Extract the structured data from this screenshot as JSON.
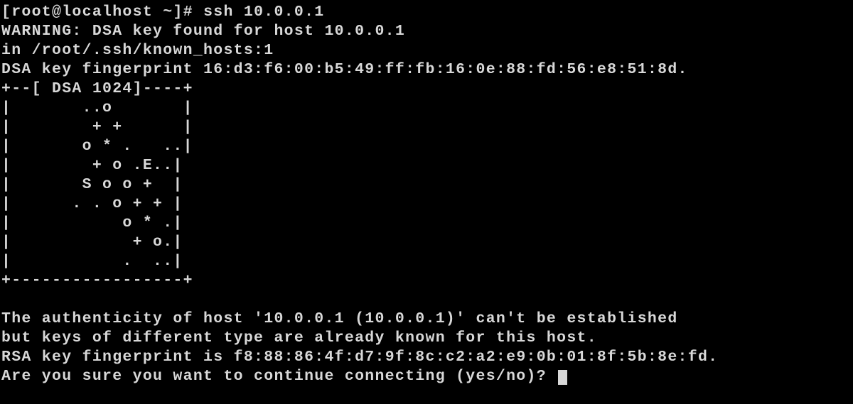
{
  "prompt": {
    "user": "root",
    "host": "localhost",
    "cwd": "~",
    "symbol": "#",
    "command": "ssh 10.0.0.1"
  },
  "warning": {
    "line1": "WARNING: DSA key found for host 10.0.0.1",
    "line2": "in /root/.ssh/known_hosts:1"
  },
  "dsa": {
    "label": "DSA key fingerprint",
    "fingerprint": "16:d3:f6:00:b5:49:ff:fb:16:0e:88:fd:56:e8:51:8d."
  },
  "randomart": {
    "header": "+--[ DSA 1024]----+",
    "rows": [
      "|       ..o       |",
      "|        + +      |",
      "|       o * .   ..|",
      "|        + o .E..|",
      "|       S o o +  |",
      "|      . . o + + |",
      "|           o * .|",
      "|            + o.|",
      "|           .  ..|"
    ],
    "footer": "+-----------------+"
  },
  "auth": {
    "line1": "The authenticity of host '10.0.0.1 (10.0.0.1)' can't be established",
    "line2": "but keys of different type are already known for this host.",
    "rsa_label": "RSA key fingerprint is",
    "rsa_fingerprint": "f8:88:86:4f:d7:9f:8c:c2:a2:e9:0b:01:8f:5b:8e:fd.",
    "prompt": "Are you sure you want to continue connecting (yes/no)? "
  }
}
